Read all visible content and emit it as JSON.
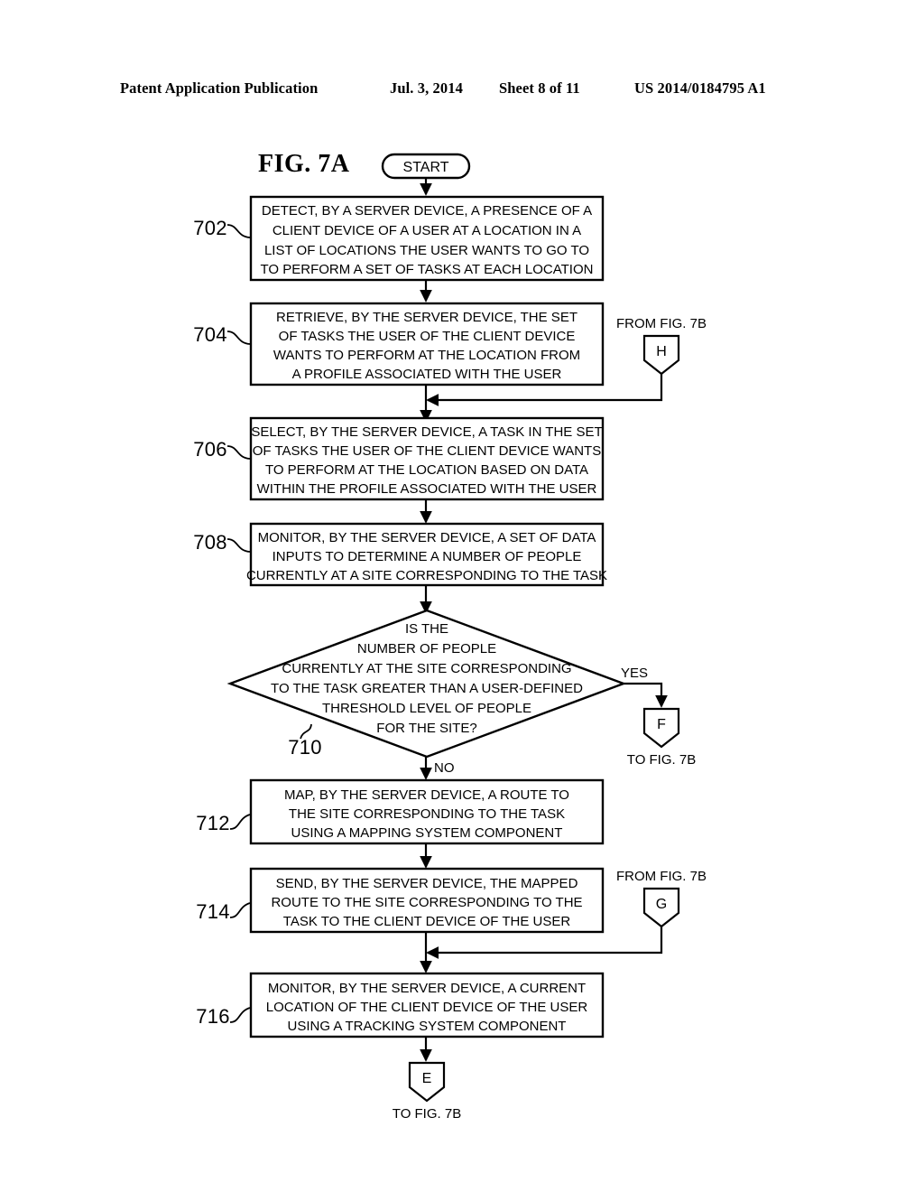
{
  "header": {
    "publication": "Patent Application Publication",
    "date": "Jul. 3, 2014",
    "sheet": "Sheet 8 of 11",
    "number": "US 2014/0184795 A1"
  },
  "figure": {
    "title": "FIG. 7A"
  },
  "flowchart": {
    "start_label": "START",
    "steps": [
      {
        "ref": "702",
        "lines": [
          "DETECT, BY A SERVER DEVICE, A PRESENCE OF A",
          "CLIENT DEVICE OF A USER AT A LOCATION IN A",
          "LIST OF LOCATIONS THE USER WANTS TO GO TO",
          "TO PERFORM A SET OF TASKS AT EACH LOCATION"
        ]
      },
      {
        "ref": "704",
        "lines": [
          "RETRIEVE, BY THE SERVER DEVICE, THE SET",
          "OF TASKS THE USER OF THE CLIENT DEVICE",
          "WANTS TO PERFORM AT THE LOCATION FROM",
          "A PROFILE ASSOCIATED WITH THE USER"
        ]
      },
      {
        "ref": "706",
        "lines": [
          "SELECT, BY THE SERVER DEVICE, A TASK IN THE SET",
          "OF TASKS THE USER OF THE CLIENT DEVICE WANTS",
          "TO PERFORM AT THE LOCATION BASED ON DATA",
          "WITHIN THE PROFILE ASSOCIATED WITH THE USER"
        ]
      },
      {
        "ref": "708",
        "lines": [
          "MONITOR, BY THE SERVER DEVICE, A SET OF DATA",
          "INPUTS TO DETERMINE A NUMBER OF PEOPLE",
          "CURRENTLY AT A SITE CORRESPONDING TO THE TASK"
        ]
      },
      {
        "ref": "712",
        "lines": [
          "MAP, BY THE SERVER DEVICE, A ROUTE TO",
          "THE SITE CORRESPONDING TO THE TASK",
          "USING A MAPPING SYSTEM COMPONENT"
        ]
      },
      {
        "ref": "714",
        "lines": [
          "SEND, BY THE SERVER DEVICE, THE MAPPED",
          "ROUTE TO THE SITE CORRESPONDING TO THE",
          "TASK TO THE CLIENT DEVICE OF THE USER"
        ]
      },
      {
        "ref": "716",
        "lines": [
          "MONITOR, BY THE SERVER DEVICE, A CURRENT",
          "LOCATION OF THE CLIENT DEVICE OF THE USER",
          "USING A TRACKING SYSTEM COMPONENT"
        ]
      }
    ],
    "decision": {
      "ref": "710",
      "lines": [
        "IS THE",
        "NUMBER OF PEOPLE",
        "CURRENTLY AT THE SITE CORRESPONDING",
        "TO THE TASK GREATER THAN A USER-DEFINED",
        "THRESHOLD LEVEL OF PEOPLE",
        "FOR THE SITE?"
      ],
      "yes_label": "YES",
      "no_label": "NO"
    },
    "connectors": [
      {
        "id": "H",
        "caption": "FROM FIG. 7B",
        "caption_position": "above"
      },
      {
        "id": "F",
        "caption": "TO FIG. 7B",
        "caption_position": "below"
      },
      {
        "id": "G",
        "caption": "FROM FIG. 7B",
        "caption_position": "above"
      },
      {
        "id": "E",
        "caption": "TO FIG. 7B",
        "caption_position": "below"
      }
    ]
  }
}
